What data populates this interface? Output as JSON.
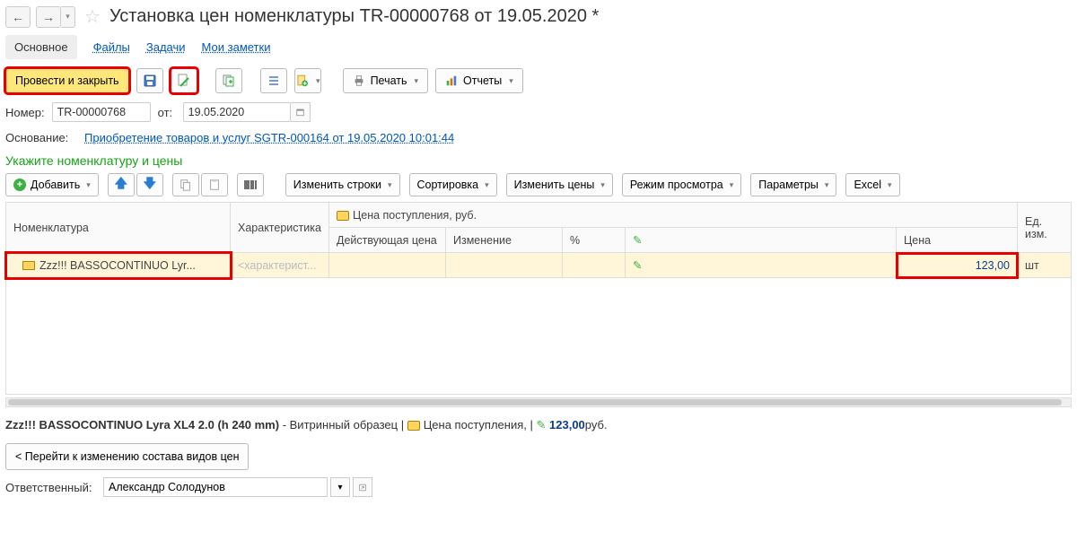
{
  "header": {
    "title": "Установка цен номенклатуры TR-00000768 от 19.05.2020 *"
  },
  "tabs": {
    "main": "Основное",
    "files": "Файлы",
    "tasks": "Задачи",
    "notes": "Мои заметки"
  },
  "toolbar": {
    "post_close": "Провести и закрыть",
    "print": "Печать",
    "reports": "Отчеты"
  },
  "form": {
    "number_label": "Номер:",
    "number_value": "TR-00000768",
    "from_label": "от:",
    "date_value": "19.05.2020",
    "basis_label": "Основание:",
    "basis_link": "Приобретение товаров и услуг SGTR-000164 от 19.05.2020 10:01:44"
  },
  "section": {
    "title": "Укажите номенклатуру и цены"
  },
  "table_toolbar": {
    "add": "Добавить",
    "edit_rows": "Изменить строки",
    "sort": "Сортировка",
    "edit_prices": "Изменить цены",
    "view_mode": "Режим просмотра",
    "params": "Параметры",
    "excel": "Excel"
  },
  "columns": {
    "nomenclature": "Номенклатура",
    "characteristic": "Характеристика",
    "price_group": "Цена поступления, руб.",
    "current_price": "Действующая цена",
    "change": "Изменение",
    "percent": "%",
    "price": "Цена",
    "unit": "Ед. изм."
  },
  "row": {
    "name": "Zzz!!! BASSOCONTINUO Lyr...",
    "char_placeholder": "<характерист...",
    "price": "123,00",
    "unit": "шт"
  },
  "status": {
    "item_name": "Zzz!!! BASSOCONTINUO Lyra XL4 2.0 (h 240 mm)",
    "variant": " - Витринный образец",
    "price_label": "Цена поступления,",
    "price_value": "123,00",
    "currency": "руб."
  },
  "bottom_button": "< Перейти к изменению состава видов цен",
  "responsible": {
    "label": "Ответственный:",
    "value": "Александр Солодунов"
  }
}
